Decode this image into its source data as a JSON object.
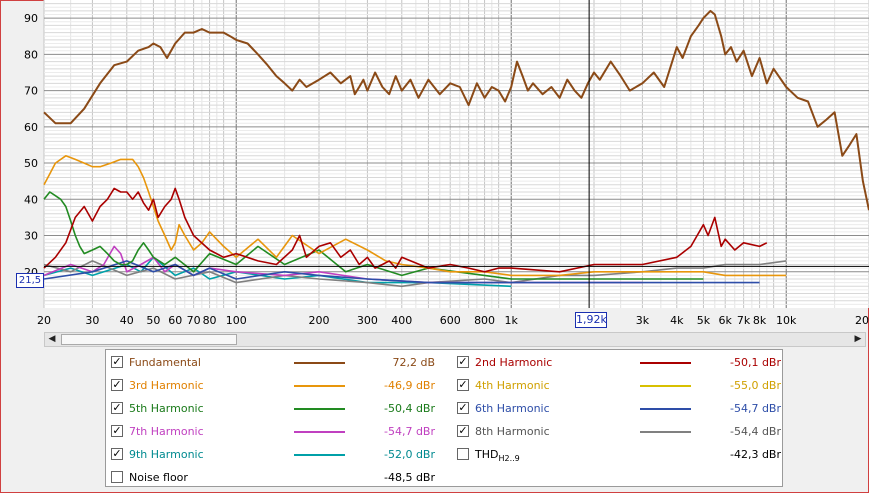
{
  "cursor": {
    "x_readout": "1,92k",
    "y_readout": "21,5"
  },
  "chart_data": {
    "type": "line",
    "x_scale": "log",
    "xlim": [
      20,
      20000
    ],
    "ylim": [
      10,
      95
    ],
    "y_ticks": [
      20,
      30,
      40,
      50,
      60,
      70,
      80,
      90
    ],
    "x_ticks": [
      {
        "value": 20,
        "label": "20"
      },
      {
        "value": 30,
        "label": "30"
      },
      {
        "value": 40,
        "label": "40"
      },
      {
        "value": 50,
        "label": "50"
      },
      {
        "value": 60,
        "label": "60"
      },
      {
        "value": 70,
        "label": "70"
      },
      {
        "value": 80,
        "label": "80"
      },
      {
        "value": 100,
        "label": "100"
      },
      {
        "value": 200,
        "label": "200"
      },
      {
        "value": 300,
        "label": "300"
      },
      {
        "value": 400,
        "label": "400"
      },
      {
        "value": 600,
        "label": "600"
      },
      {
        "value": 800,
        "label": "800"
      },
      {
        "value": 1000,
        "label": "1k"
      },
      {
        "value": 3000,
        "label": "3k"
      },
      {
        "value": 4000,
        "label": "4k"
      },
      {
        "value": 5000,
        "label": "5k"
      },
      {
        "value": 6000,
        "label": "6k"
      },
      {
        "value": 7000,
        "label": "7k"
      },
      {
        "value": 8000,
        "label": "8k"
      },
      {
        "value": 10000,
        "label": "10k"
      },
      {
        "value": 20000,
        "label": "20"
      }
    ],
    "grid": true,
    "cursor_x": 1920,
    "cursor_y": 21.5,
    "series": [
      {
        "name": "Fundamental",
        "color": "#8b4a17",
        "visible": true,
        "x": [
          20,
          22,
          25,
          28,
          32,
          36,
          40,
          44,
          48,
          50,
          53,
          56,
          60,
          65,
          70,
          75,
          80,
          85,
          90,
          95,
          100,
          110,
          120,
          130,
          140,
          150,
          160,
          170,
          180,
          200,
          220,
          240,
          260,
          270,
          280,
          290,
          300,
          320,
          340,
          360,
          380,
          400,
          430,
          460,
          500,
          550,
          600,
          650,
          700,
          750,
          800,
          850,
          900,
          950,
          1000,
          1050,
          1100,
          1150,
          1200,
          1300,
          1400,
          1500,
          1600,
          1700,
          1800,
          1900,
          2000,
          2100,
          2300,
          2500,
          2700,
          3000,
          3300,
          3600,
          4000,
          4200,
          4500,
          4800,
          5000,
          5300,
          5500,
          5800,
          6000,
          6300,
          6600,
          7000,
          7500,
          8000,
          8500,
          9000,
          10000,
          11000,
          12000,
          13000,
          14000,
          15000,
          16000,
          17000,
          18000,
          19000,
          20000
        ],
        "y": [
          64,
          61,
          61,
          65,
          72,
          77,
          78,
          81,
          82,
          83,
          82,
          79,
          83,
          86,
          86,
          87,
          86,
          86,
          86,
          85,
          84,
          83,
          80,
          77,
          74,
          72,
          70,
          73,
          71,
          73,
          75,
          72,
          74,
          69,
          71,
          73,
          70,
          75,
          71,
          69,
          74,
          70,
          73,
          68,
          73,
          69,
          72,
          71,
          66,
          72,
          68,
          71,
          70,
          67,
          71,
          78,
          74,
          70,
          72,
          69,
          71,
          68,
          73,
          70,
          68,
          72,
          75,
          73,
          78,
          74,
          70,
          72,
          75,
          71,
          82,
          79,
          85,
          88,
          90,
          92,
          91,
          85,
          80,
          82,
          78,
          81,
          74,
          79,
          72,
          76,
          71,
          68,
          67,
          60,
          62,
          64,
          52,
          55,
          58,
          45,
          37
        ]
      },
      {
        "name": "2nd Harmonic",
        "color": "#aa0000",
        "visible": true,
        "x": [
          20,
          22,
          24,
          26,
          28,
          30,
          32,
          34,
          36,
          38,
          40,
          42,
          44,
          46,
          48,
          50,
          52,
          55,
          58,
          60,
          62,
          65,
          70,
          80,
          90,
          100,
          120,
          140,
          160,
          170,
          180,
          200,
          220,
          240,
          260,
          280,
          300,
          320,
          340,
          360,
          380,
          400,
          500,
          600,
          700,
          800,
          900,
          1000,
          1500,
          2000,
          3000,
          4000,
          4500,
          5000,
          5200,
          5500,
          5800,
          6000,
          6500,
          7000,
          8000,
          8500
        ],
        "y": [
          21,
          24,
          28,
          35,
          38,
          34,
          38,
          40,
          43,
          42,
          42,
          40,
          42,
          39,
          37,
          40,
          35,
          38,
          40,
          43,
          40,
          35,
          30,
          26,
          24,
          25,
          23,
          22,
          26,
          30,
          24,
          27,
          28,
          24,
          26,
          22,
          24,
          21,
          22,
          23,
          21,
          24,
          21,
          22,
          21,
          20,
          21,
          21,
          20,
          22,
          22,
          24,
          27,
          33,
          30,
          35,
          27,
          29,
          26,
          28,
          27,
          28
        ]
      },
      {
        "name": "3rd Harmonic",
        "color": "#e8960c",
        "visible": true,
        "x": [
          20,
          21,
          22,
          24,
          26,
          28,
          30,
          32,
          35,
          38,
          40,
          42,
          44,
          46,
          48,
          50,
          52,
          55,
          58,
          60,
          62,
          65,
          70,
          75,
          80,
          90,
          100,
          120,
          140,
          160,
          200,
          250,
          300,
          350,
          400,
          500,
          600,
          800,
          1000,
          1500,
          2000,
          3000,
          4000,
          5000,
          6000,
          8000,
          10000
        ],
        "y": [
          44,
          47,
          50,
          52,
          51,
          50,
          49,
          49,
          50,
          51,
          51,
          51,
          49,
          46,
          42,
          38,
          34,
          30,
          26,
          28,
          33,
          30,
          26,
          28,
          31,
          27,
          24,
          29,
          24,
          30,
          25,
          29,
          26,
          23,
          22,
          21,
          20,
          20,
          19,
          19,
          20,
          20,
          20,
          20,
          19,
          19,
          19
        ]
      },
      {
        "name": "4th Harmonic",
        "color": "#d8c000",
        "visible": false,
        "x": [
          20,
          40,
          60,
          100,
          200,
          400,
          1000,
          3000,
          10000
        ],
        "y": [
          20,
          22,
          24,
          22,
          24,
          21,
          19,
          19,
          19
        ]
      },
      {
        "name": "5th Harmonic",
        "color": "#228b22",
        "visible": true,
        "x": [
          20,
          21,
          22,
          23,
          24,
          25,
          26,
          27,
          28,
          30,
          32,
          34,
          36,
          38,
          40,
          42,
          44,
          46,
          48,
          50,
          55,
          60,
          70,
          80,
          100,
          120,
          150,
          200,
          250,
          300,
          400,
          500,
          1000,
          2000,
          5000
        ],
        "y": [
          40,
          42,
          41,
          40,
          38,
          34,
          30,
          27,
          25,
          26,
          27,
          25,
          23,
          22,
          22,
          23,
          26,
          28,
          26,
          24,
          22,
          24,
          20,
          25,
          22,
          27,
          22,
          26,
          20,
          22,
          19,
          21,
          18,
          18,
          18
        ]
      },
      {
        "name": "6th Harmonic",
        "color": "#2e4ea8",
        "visible": true,
        "x": [
          20,
          30,
          40,
          50,
          60,
          70,
          80,
          100,
          150,
          200,
          300,
          500,
          1000,
          3000,
          8000
        ],
        "y": [
          18,
          20,
          23,
          20,
          22,
          19,
          21,
          18,
          20,
          19,
          18,
          17,
          17,
          17,
          17
        ]
      },
      {
        "name": "7th Harmonic",
        "color": "#c040c0",
        "visible": true,
        "x": [
          20,
          25,
          30,
          33,
          36,
          38,
          40,
          45,
          50,
          55,
          60,
          70,
          80,
          100,
          150,
          200,
          300,
          500,
          1000,
          3000
        ],
        "y": [
          19,
          22,
          20,
          22,
          27,
          25,
          20,
          22,
          24,
          20,
          22,
          19,
          21,
          20,
          19,
          20,
          18,
          17,
          17,
          17
        ]
      },
      {
        "name": "8th Harmonic",
        "color": "#808080",
        "visible": true,
        "x": [
          20,
          25,
          30,
          40,
          50,
          60,
          80,
          100,
          150,
          200,
          300,
          400,
          500,
          800,
          1000,
          1500,
          2000,
          3000,
          4000,
          5000,
          6000,
          8000,
          10000
        ],
        "y": [
          22,
          20,
          23,
          19,
          21,
          18,
          20,
          17,
          19,
          18,
          17,
          16,
          17,
          18,
          17,
          19,
          19,
          20,
          21,
          21,
          22,
          22,
          23
        ]
      },
      {
        "name": "9th Harmonic",
        "color": "#00a0a8",
        "visible": true,
        "x": [
          20,
          25,
          30,
          40,
          45,
          50,
          60,
          70,
          80,
          100,
          150,
          200,
          300,
          500,
          1000
        ],
        "y": [
          19,
          21,
          19,
          22,
          20,
          24,
          19,
          21,
          18,
          20,
          18,
          19,
          17,
          17,
          16
        ]
      },
      {
        "name": "THD H2..9",
        "color": "#c8c8c8",
        "visible": false,
        "x": [
          20,
          25,
          30,
          40,
          50,
          60,
          80,
          100,
          150,
          200,
          300,
          500,
          700,
          1000,
          1500,
          2000,
          3000,
          4000,
          5000,
          6000,
          8000,
          10000
        ],
        "y": [
          20,
          25,
          32,
          26,
          22,
          24,
          20,
          19,
          21,
          20,
          20,
          19,
          21,
          20,
          22,
          21,
          22,
          22,
          24,
          25,
          26,
          27
        ]
      }
    ]
  },
  "legend": {
    "items": [
      {
        "name": "Fundamental",
        "value": "72,2 dB",
        "checked": true,
        "label_color": "#8b4a17",
        "value_color": "#8b4a17",
        "line_color": "#8b4a17"
      },
      {
        "name": "2nd Harmonic",
        "value": "-50,1 dBr",
        "checked": true,
        "label_color": "#aa0000",
        "value_color": "#aa0000",
        "line_color": "#aa0000"
      },
      {
        "name": "3rd Harmonic",
        "value": "-46,9 dBr",
        "checked": true,
        "label_color": "#e08000",
        "value_color": "#e08000",
        "line_color": "#e8960c"
      },
      {
        "name": "4th Harmonic",
        "value": "-55,0 dBr",
        "checked": true,
        "label_color": "#d0a000",
        "value_color": "#d0a000",
        "line_color": "#d8c000"
      },
      {
        "name": "5th Harmonic",
        "value": "-50,4 dBr",
        "checked": true,
        "label_color": "#1a7a1a",
        "value_color": "#1a7a1a",
        "line_color": "#228b22"
      },
      {
        "name": "6th Harmonic",
        "value": "-54,7 dBr",
        "checked": true,
        "label_color": "#2e4ea8",
        "value_color": "#2e4ea8",
        "line_color": "#2e4ea8"
      },
      {
        "name": "7th Harmonic",
        "value": "-54,7 dBr",
        "checked": true,
        "label_color": "#c040c0",
        "value_color": "#c040c0",
        "line_color": "#c040c0"
      },
      {
        "name": "8th Harmonic",
        "value": "-54,4 dBr",
        "checked": true,
        "label_color": "#555555",
        "value_color": "#555555",
        "line_color": "#808080"
      },
      {
        "name": "9th Harmonic",
        "value": "-52,0 dBr",
        "checked": true,
        "label_color": "#008a90",
        "value_color": "#008a90",
        "line_color": "#00a0a8"
      },
      {
        "name": "THD",
        "name_sub": "H2..9",
        "value": "-42,3 dBr",
        "checked": false,
        "label_color": "#000000",
        "value_color": "#000000",
        "line_color": ""
      },
      {
        "name": "Noise floor",
        "value": "-48,5 dBr",
        "checked": false,
        "label_color": "#000000",
        "value_color": "#000000",
        "line_color": ""
      }
    ]
  }
}
